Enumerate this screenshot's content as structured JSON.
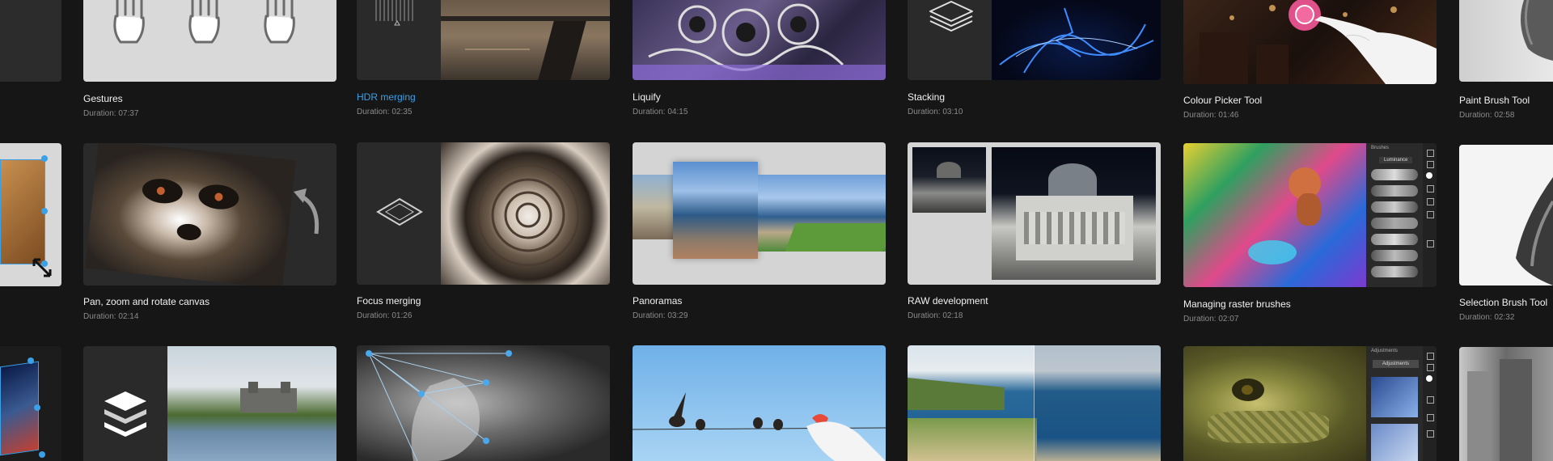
{
  "colors": {
    "background": "#161616",
    "accent": "#3aa0e8",
    "title": "#f2f2f2",
    "duration": "#8b8b8b"
  },
  "cards": {
    "gestures": {
      "title": "Gestures",
      "duration": "Duration: 07:37"
    },
    "hdr_merging": {
      "title": "HDR merging",
      "duration": "Duration: 02:35"
    },
    "liquify": {
      "title": "Liquify",
      "duration": "Duration: 04:15"
    },
    "stacking": {
      "title": "Stacking",
      "duration": "Duration: 03:10"
    },
    "colour_picker": {
      "title": "Colour Picker Tool",
      "duration": "Duration: 01:46"
    },
    "paint_brush": {
      "title": "Paint Brush Tool",
      "duration": "Duration: 02:58"
    },
    "pan_zoom": {
      "title": "Pan, zoom and rotate canvas",
      "duration": "Duration: 02:14"
    },
    "focus_merging": {
      "title": "Focus merging",
      "duration": "Duration: 01:26"
    },
    "panoramas": {
      "title": "Panoramas",
      "duration": "Duration: 03:29"
    },
    "raw_development": {
      "title": "RAW development",
      "duration": "Duration: 02:18"
    },
    "raster_brushes": {
      "title": "Managing raster brushes",
      "duration": "Duration: 02:07"
    },
    "selection_brush": {
      "title": "Selection Brush Tool",
      "duration": "Duration: 02:32"
    }
  },
  "panel_labels": {
    "brushes": "Brushes",
    "luminance": "Luminance",
    "adjustments": "Adjustments",
    "adjustments_btn": "Adjustments"
  }
}
